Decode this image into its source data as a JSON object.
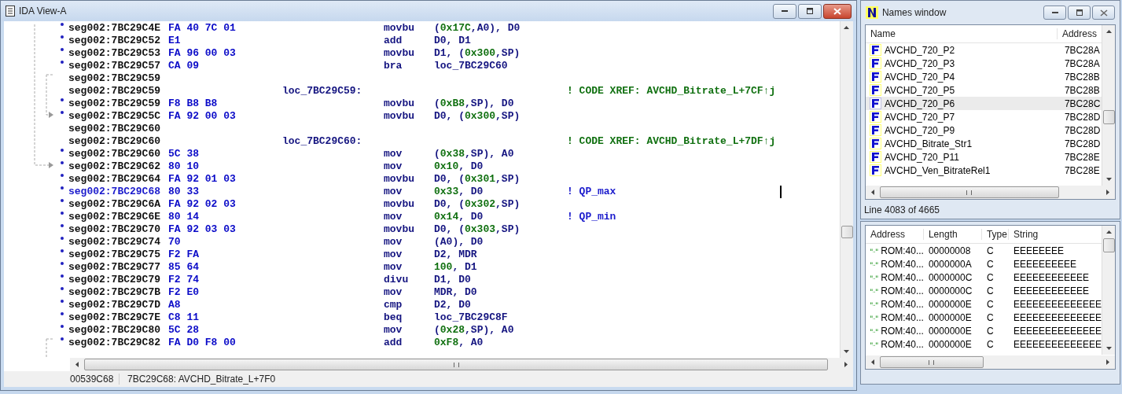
{
  "ida_view": {
    "title": "IDA View-A",
    "lines": [
      {
        "kind": "code",
        "selected": false,
        "address": "seg002:7BC29C4E",
        "bytes": "FA 40 7C 01",
        "mnemonic": "movbu",
        "operands": [
          {
            "text": "(",
            "kind": "reg"
          },
          {
            "text": "0x17C",
            "kind": "num"
          },
          {
            "text": ",A0), D0",
            "kind": "reg"
          }
        ]
      },
      {
        "kind": "code",
        "selected": false,
        "address": "seg002:7BC29C52",
        "bytes": "E1",
        "mnemonic": "add",
        "operands": [
          {
            "text": "D0, D1",
            "kind": "reg"
          }
        ]
      },
      {
        "kind": "code",
        "selected": false,
        "address": "seg002:7BC29C53",
        "bytes": "FA 96 00 03",
        "mnemonic": "movbu",
        "operands": [
          {
            "text": "D1, (",
            "kind": "reg"
          },
          {
            "text": "0x300",
            "kind": "num"
          },
          {
            "text": ",SP)",
            "kind": "reg"
          }
        ]
      },
      {
        "kind": "code",
        "selected": false,
        "address": "seg002:7BC29C57",
        "bytes": "CA 09",
        "mnemonic": "bra",
        "operands": [
          {
            "text": "loc_7BC29C60",
            "kind": "reg"
          }
        ]
      },
      {
        "kind": "blank",
        "selected": false,
        "address": "seg002:7BC29C59"
      },
      {
        "kind": "label",
        "selected": false,
        "address": "seg002:7BC29C59",
        "label": "loc_7BC29C59:",
        "comment": {
          "kind": "xref",
          "text": "! CODE XREF: AVCHD_Bitrate_L+7CF↑j"
        }
      },
      {
        "kind": "code",
        "selected": false,
        "address": "seg002:7BC29C59",
        "bytes": "F8 B8 B8",
        "mnemonic": "movbu",
        "operands": [
          {
            "text": "(",
            "kind": "reg"
          },
          {
            "text": "0xB8",
            "kind": "num"
          },
          {
            "text": ",SP), D0",
            "kind": "reg"
          }
        ]
      },
      {
        "kind": "code",
        "selected": false,
        "address": "seg002:7BC29C5C",
        "bytes": "FA 92 00 03",
        "mnemonic": "movbu",
        "operands": [
          {
            "text": "D0, (",
            "kind": "reg"
          },
          {
            "text": "0x300",
            "kind": "num"
          },
          {
            "text": ",SP)",
            "kind": "reg"
          }
        ]
      },
      {
        "kind": "blank",
        "selected": false,
        "address": "seg002:7BC29C60"
      },
      {
        "kind": "label",
        "selected": false,
        "address": "seg002:7BC29C60",
        "label": "loc_7BC29C60:",
        "comment": {
          "kind": "xref",
          "text": "! CODE XREF: AVCHD_Bitrate_L+7DF↑j"
        }
      },
      {
        "kind": "code",
        "selected": false,
        "address": "seg002:7BC29C60",
        "bytes": "5C 38",
        "mnemonic": "mov",
        "operands": [
          {
            "text": "(",
            "kind": "reg"
          },
          {
            "text": "0x38",
            "kind": "num"
          },
          {
            "text": ",SP), A0",
            "kind": "reg"
          }
        ]
      },
      {
        "kind": "code",
        "selected": false,
        "address": "seg002:7BC29C62",
        "bytes": "80 10",
        "mnemonic": "mov",
        "operands": [
          {
            "text": "0x10",
            "kind": "num"
          },
          {
            "text": ", D0",
            "kind": "reg"
          }
        ]
      },
      {
        "kind": "code",
        "selected": false,
        "address": "seg002:7BC29C64",
        "bytes": "FA 92 01 03",
        "mnemonic": "movbu",
        "operands": [
          {
            "text": "D0, (",
            "kind": "reg"
          },
          {
            "text": "0x301",
            "kind": "num"
          },
          {
            "text": ",SP)",
            "kind": "reg"
          }
        ]
      },
      {
        "kind": "code",
        "selected": true,
        "address": "seg002:7BC29C68",
        "bytes": "80 33",
        "mnemonic": "mov",
        "operands": [
          {
            "text": "0x33",
            "kind": "num"
          },
          {
            "text": ", D0",
            "kind": "reg"
          }
        ],
        "comment": {
          "kind": "user",
          "text": "! QP_max"
        }
      },
      {
        "kind": "code",
        "selected": false,
        "address": "seg002:7BC29C6A",
        "bytes": "FA 92 02 03",
        "mnemonic": "movbu",
        "operands": [
          {
            "text": "D0, (",
            "kind": "reg"
          },
          {
            "text": "0x302",
            "kind": "num"
          },
          {
            "text": ",SP)",
            "kind": "reg"
          }
        ]
      },
      {
        "kind": "code",
        "selected": false,
        "address": "seg002:7BC29C6E",
        "bytes": "80 14",
        "mnemonic": "mov",
        "operands": [
          {
            "text": "0x14",
            "kind": "num"
          },
          {
            "text": ", D0",
            "kind": "reg"
          }
        ],
        "comment": {
          "kind": "user",
          "text": "! QP_min"
        }
      },
      {
        "kind": "code",
        "selected": false,
        "address": "seg002:7BC29C70",
        "bytes": "FA 92 03 03",
        "mnemonic": "movbu",
        "operands": [
          {
            "text": "D0, (",
            "kind": "reg"
          },
          {
            "text": "0x303",
            "kind": "num"
          },
          {
            "text": ",SP)",
            "kind": "reg"
          }
        ]
      },
      {
        "kind": "code",
        "selected": false,
        "address": "seg002:7BC29C74",
        "bytes": "70",
        "mnemonic": "mov",
        "operands": [
          {
            "text": "(A0), D0",
            "kind": "reg"
          }
        ]
      },
      {
        "kind": "code",
        "selected": false,
        "address": "seg002:7BC29C75",
        "bytes": "F2 FA",
        "mnemonic": "mov",
        "operands": [
          {
            "text": "D2, MDR",
            "kind": "reg"
          }
        ]
      },
      {
        "kind": "code",
        "selected": false,
        "address": "seg002:7BC29C77",
        "bytes": "85 64",
        "mnemonic": "mov",
        "operands": [
          {
            "text": "100",
            "kind": "num"
          },
          {
            "text": ", D1",
            "kind": "reg"
          }
        ]
      },
      {
        "kind": "code",
        "selected": false,
        "address": "seg002:7BC29C79",
        "bytes": "F2 74",
        "mnemonic": "divu",
        "operands": [
          {
            "text": "D1, D0",
            "kind": "reg"
          }
        ]
      },
      {
        "kind": "code",
        "selected": false,
        "address": "seg002:7BC29C7B",
        "bytes": "F2 E0",
        "mnemonic": "mov",
        "operands": [
          {
            "text": "MDR, D0",
            "kind": "reg"
          }
        ]
      },
      {
        "kind": "code",
        "selected": false,
        "address": "seg002:7BC29C7D",
        "bytes": "A8",
        "mnemonic": "cmp",
        "operands": [
          {
            "text": "D2, D0",
            "kind": "reg"
          }
        ]
      },
      {
        "kind": "code",
        "selected": false,
        "address": "seg002:7BC29C7E",
        "bytes": "C8 11",
        "mnemonic": "beq",
        "operands": [
          {
            "text": "loc_7BC29C8F",
            "kind": "reg"
          }
        ]
      },
      {
        "kind": "code",
        "selected": false,
        "address": "seg002:7BC29C80",
        "bytes": "5C 28",
        "mnemonic": "mov",
        "operands": [
          {
            "text": "(",
            "kind": "reg"
          },
          {
            "text": "0x28",
            "kind": "num"
          },
          {
            "text": ",SP), A0",
            "kind": "reg"
          }
        ]
      },
      {
        "kind": "code",
        "selected": false,
        "address": "seg002:7BC29C82",
        "bytes": "FA D0 F8 00",
        "mnemonic": "add",
        "operands": [
          {
            "text": "0xF8",
            "kind": "num"
          },
          {
            "text": ", A0",
            "kind": "reg"
          }
        ]
      }
    ],
    "status_bar": {
      "offset": "00539C68",
      "location": "7BC29C68: AVCHD_Bitrate_L+7F0"
    }
  },
  "names_window": {
    "title": "Names window",
    "columns": [
      "Name",
      "Address"
    ],
    "rows": [
      {
        "name": "AVCHD_720_P2",
        "address": "7BC28A",
        "selected": false
      },
      {
        "name": "AVCHD_720_P3",
        "address": "7BC28A",
        "selected": false
      },
      {
        "name": "AVCHD_720_P4",
        "address": "7BC28B",
        "selected": false
      },
      {
        "name": "AVCHD_720_P5",
        "address": "7BC28B",
        "selected": false
      },
      {
        "name": "AVCHD_720_P6",
        "address": "7BC28C",
        "selected": true
      },
      {
        "name": "AVCHD_720_P7",
        "address": "7BC28D",
        "selected": false
      },
      {
        "name": "AVCHD_720_P9",
        "address": "7BC28D",
        "selected": false
      },
      {
        "name": "AVCHD_Bitrate_Str1",
        "address": "7BC28D",
        "selected": false
      },
      {
        "name": "AVCHD_720_P11",
        "address": "7BC28E",
        "selected": false
      },
      {
        "name": "AVCHD_Ven_BitrateRel1",
        "address": "7BC28E",
        "selected": false
      }
    ],
    "status": "Line 4083 of 4665"
  },
  "strings_window": {
    "columns": [
      "Address",
      "Length",
      "Type",
      "String"
    ],
    "rows": [
      {
        "address": "ROM:40...",
        "length": "00000008",
        "type": "C",
        "string": "EEEEEEEE"
      },
      {
        "address": "ROM:40...",
        "length": "0000000A",
        "type": "C",
        "string": "EEEEEEEEEE"
      },
      {
        "address": "ROM:40...",
        "length": "0000000C",
        "type": "C",
        "string": "EEEEEEEEEEEE"
      },
      {
        "address": "ROM:40...",
        "length": "0000000C",
        "type": "C",
        "string": "EEEEEEEEEEEE"
      },
      {
        "address": "ROM:40...",
        "length": "0000000E",
        "type": "C",
        "string": "EEEEEEEEEEEEEE"
      },
      {
        "address": "ROM:40...",
        "length": "0000000E",
        "type": "C",
        "string": "EEEEEEEEEEEEEE"
      },
      {
        "address": "ROM:40...",
        "length": "0000000E",
        "type": "C",
        "string": "EEEEEEEEEEEEEE"
      },
      {
        "address": "ROM:40...",
        "length": "0000000E",
        "type": "C",
        "string": "EEEEEEEEEEEEEE"
      }
    ]
  }
}
